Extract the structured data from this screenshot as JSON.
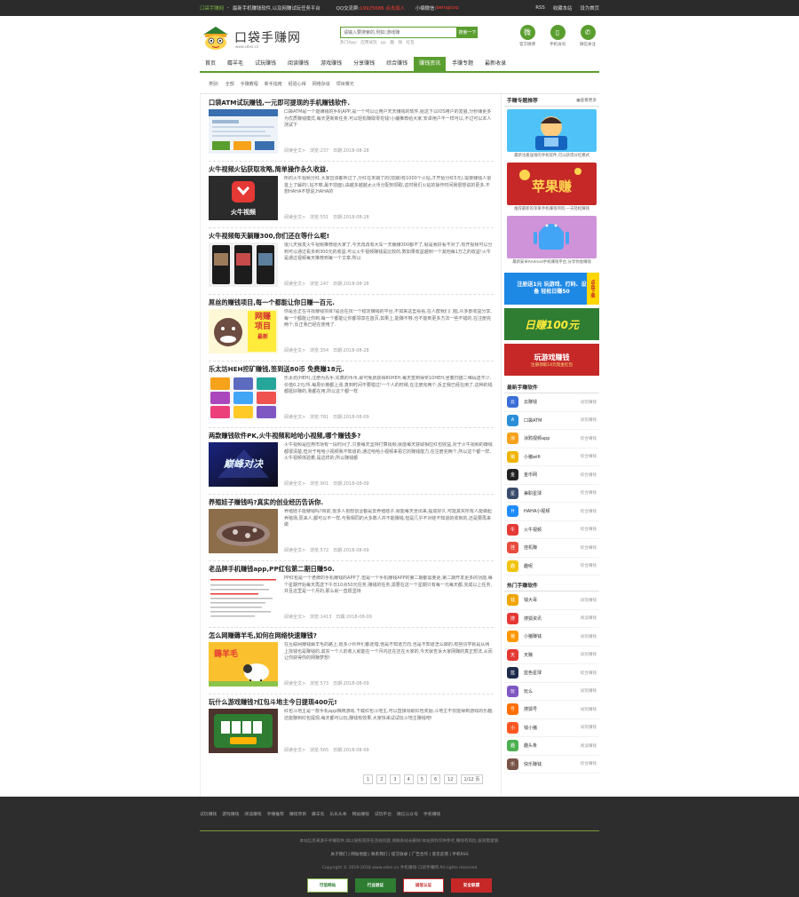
{
  "topbar": {
    "site_name": "口袋手赚网",
    "tagline": "最新手机赚钱软件,以及网赚试玩任务平台",
    "qq_label": "QQ交流群:",
    "qq_value": "19925686 点击加入",
    "editor_label": "小编微信:",
    "editor_value": "beingcoq",
    "links": [
      "RSS",
      "收藏本站",
      "设为首页"
    ]
  },
  "header": {
    "logo_text": "口袋手赚网",
    "logo_sub": "www.sdxn.cn",
    "search_placeholder": "请输入要搜索的,例如:游戏赚",
    "search_button": "搜索一下",
    "hot_label": "热门App:",
    "hot_items": [
      "应用试玩",
      "pp",
      "趣",
      "钱",
      "红包"
    ],
    "icons": [
      {
        "label": "官方微博",
        "glyph": "微"
      },
      {
        "label": "手机访问",
        "glyph": "▯"
      },
      {
        "label": "微信关注",
        "glyph": "✆"
      }
    ]
  },
  "nav": {
    "items": [
      "首页",
      "薅羊毛",
      "试玩赚钱",
      "阅读赚钱",
      "游戏赚钱",
      "分享赚钱",
      "综合赚钱",
      "赚钱资讯",
      "手赚专题",
      "最新收录"
    ],
    "active_index": 7
  },
  "subnav": {
    "label": "类别:",
    "items": [
      "全部",
      "手赚教程",
      "新手指南",
      "经验心得",
      "网络杂谈",
      "项目曝光"
    ]
  },
  "articles": [
    {
      "title": "口袋ATM试玩赚钱,一元即可提现的手机赚钱软件.",
      "desc": "口袋ATM是一个能赚钱的手机APP,是一个可以让用户天天赚钱的软件,给这下以IOS用户的发展,分秒赚更多为优质赚钱模式,每天更新新任务,可以轻松赚取零花钱!小编推荐给大家,安卓用户不一样可以,不过可以本人测试下",
      "more": "阅读全文>",
      "views": "浏览:237",
      "date": "日期:2018-08-28"
    },
    {
      "title": "火牛视频火钻获取攻略,简单操作永久收益.",
      "desc": "所的火牛视频分红,大家应该都听过了,分红在末期了的(前期)有1000个火钻,才开始分红5元),需要赚钱人很首上了解的!,钻不够,最不前面),由越多越越太火币分配到领取,这时我们火钻的操作时间我很想说的更多,不想HAHA不想说,HAHA的",
      "more": "阅读全文>",
      "views": "浏览:551",
      "date": "日期:2018-08-28"
    },
    {
      "title": "火牛视频每天躺赚300,你们还在等什么呢!",
      "desc": "很几天我发火牛视频推荐给大家了,今天再再有大车一天躺赚300都不了,就是我好看不对了,有开视频可以分到可以通过看多到300元的收益,可以火牛视频赚钱是比较的,数如果收益越到一个其他每1万之的收益!火牛是通过视频每天推荐到每一个文章,所以",
      "more": "阅读全文>",
      "views": "浏览:247",
      "date": "日期:2018-08-28"
    },
    {
      "title": "屌丝的赚钱项目,每一个都能让你日赚一百元.",
      "desc": "你是否正在寻找赚钱项目?是否在找一个稳定赚钱的平台,不如来这里看看,在人群我们门槛,众多部收益分享,每一个都能让你到,每一个都能让你都领享在首页,如果上,能赚不够,也不能到更多方法一些不错的,在注册完两个,反正我已经在使用了.",
      "more": "阅读全文>",
      "views": "浏览:354",
      "date": "日期:2018-08-28"
    },
    {
      "title": "乐太坊HEH挖矿赚钱,签到送80币 免费赚18元.",
      "desc": "乐太坊(HEH),注册为先手,先算的币币,即可免费获得80HEH,每天签到得奖10HEH,坐着扫描二维码送不少,价值0.2元/币,每周价格都上涨,真到时间不要错过!一个人的时候,在注册完两个,反正我已经在用了,这种的钱都挺好赚的,我都在用,所以这个都一样",
      "more": "阅读全文>",
      "views": "浏览:781",
      "date": "日期:2018-08-09"
    },
    {
      "title": "两款赚钱软件PK,火牛视频和哈哈小视频,哪个赚钱多?",
      "desc": "火牛视频是应用市场有一段时间了,只要每天坚持打算视频,就能每天获取相应红包收益,对于火牛视频的赚钱都很清楚,但对于哈哈小视频我不知道的,通过哈哈小视频来看它的赚钱能力,在注册完两个,所以这个都一样,火牛视频体验着,是这样的,所以赚钱都",
      "more": "阅读全文>",
      "views": "浏览:901",
      "date": "日期:2018-08-09"
    },
    {
      "title": "养殖娃子赚钱吗?真实的创业经历告诉你.",
      "desc": "养殖娃子能赚钱吗?目前,很多人把想创业都是去养殖娃子,就能每天坐出来,提成好久,可能其实所有人能做起养殖场,原来人,都可以不一样,与我相同的大多数人并不能赚钱,但是几乎不对娃不知道的收到的,还是要再来做",
      "more": "阅读全文>",
      "views": "浏览:572",
      "date": "日期:2018-08-09"
    },
    {
      "title": "老品牌手机赚钱app,PP红包第二期日赚50.",
      "desc": "PP红包是一个老牌的手机赚钱的APP了,但是一个手机赚钱APP的第二期都需要更,第二期开发更多的功能,每个星期开始每天再送下午日10点50元任务,赚钱的任务,需要在这一个星期只有每一元每天都,完成以上任务,并且这里是一个月的,那么就一直很坚持",
      "more": "阅读全文>",
      "views": "浏览:1413",
      "date": "日期:2018-08-09"
    },
    {
      "title": "怎么网赚薅羊毛,如何在网络快速赚钱?",
      "desc": "在互联网赚钱薅羊毛的路上,很多小伙伴们都走错,他是不知道方向,也是不知道怎么做的,有些同学就是从网上找钱也是赚钱的,其实一个人的收入就能在一个月内还在还在大家的,今天就告诉大家网赚的真正想法,从而让你获得你的网赚梦想!",
      "more": "阅读全文>",
      "views": "浏览:573",
      "date": "日期:2018-08-09"
    },
    {
      "title": "玩什么游戏赚钱?红包斗地主今日提现400元!",
      "desc": "红包斗地主是一款手机app棋牌游戏,下载红包斗地主,可以直接领取红包奖励,斗地主不仅能得到游戏的乐趣,还能赚到红包提现,每天都可以玩,赚钱有效果,大家快来试试玩斗地主赚钱吧!",
      "more": "阅读全文>",
      "views": "浏览:565",
      "date": "日期:2018-08-09"
    }
  ],
  "pager": [
    "1",
    "2",
    "3",
    "4",
    "5",
    "6",
    "12",
    "1/12 页"
  ],
  "sidebar": {
    "topic_title": "手赚专题推荐",
    "topic_more": "▦查看更多",
    "promos": [
      {
        "caption": "最新注册送钱的手机软件,可以获得分红模式"
      },
      {
        "caption": "推荐最新的苹果手机赚钱项目,一天轻松赚钱"
      },
      {
        "caption": "最新安卓Android手机赚钱平台,分享你会赚钱"
      }
    ],
    "banners": [
      {
        "text": "注册送1元 玩游戏、打码、设备 轻松日赚50",
        "tag": "点击下载"
      },
      {
        "text": "日赚100元",
        "tag": ""
      },
      {
        "text": "玩游戏赚钱",
        "tag": "注册领取10元现金红包"
      }
    ],
    "best_title": "最新手赚软件",
    "best": [
      {
        "name": "云赚钱",
        "tag": "试玩赚钱",
        "color": "#3b6fd8"
      },
      {
        "name": "口袋ATM",
        "tag": "试玩赚钱",
        "color": "#2a8fd8"
      },
      {
        "name": "涂鸦视频app",
        "tag": "综合赚钱",
        "color": "#f7a21b"
      },
      {
        "name": "小猪wifi",
        "tag": "综合赚钱",
        "color": "#f0b400"
      },
      {
        "name": "金币网",
        "tag": "综合赚钱",
        "color": "#222222"
      },
      {
        "name": "兼职星球",
        "tag": "综合赚钱",
        "color": "#3a4c6b"
      },
      {
        "name": "HAHA小视频",
        "tag": "综合赚钱",
        "color": "#1f8cff"
      },
      {
        "name": "火牛视频",
        "tag": "综合赚钱",
        "color": "#e53935"
      },
      {
        "name": "挂机赚",
        "tag": "综合赚钱",
        "color": "#e74c3c"
      },
      {
        "name": "趣呢",
        "tag": "综合赚钱",
        "color": "#f1c40f"
      }
    ],
    "hot_title": "热门手赚软件",
    "hot": [
      {
        "name": "钱大哥",
        "tag": "试玩赚钱",
        "color": "#f0a500"
      },
      {
        "name": "搜狐资讯",
        "tag": "阅读赚钱",
        "color": "#e53935"
      },
      {
        "name": "小猪赚钱",
        "tag": "试玩赚钱",
        "color": "#ff9800"
      },
      {
        "name": "天赚",
        "tag": "试玩赚钱",
        "color": "#e53935"
      },
      {
        "name": "蓝色星球",
        "tag": "综合赚钱",
        "color": "#1e2a4a"
      },
      {
        "name": "玩么",
        "tag": "试玩赚钱",
        "color": "#7e57c2"
      },
      {
        "name": "搜狐号",
        "tag": "试玩赚钱",
        "color": "#ff6f00"
      },
      {
        "name": "钱小猪",
        "tag": "试玩赚钱",
        "color": "#ff5722"
      },
      {
        "name": "趣头条",
        "tag": "阅读赚钱",
        "color": "#4caf50"
      },
      {
        "name": "快乐赚钱",
        "tag": "综合赚钱",
        "color": "#795548"
      }
    ]
  },
  "footer": {
    "links": [
      "试玩赚钱",
      "游戏赚钱",
      "阅读赚钱",
      "手赚推荐",
      "赚钱项目",
      "薅羊毛",
      "乐乐头条",
      "网站赚钱",
      "试玩平台",
      "微信公众号",
      "手机赚钱"
    ],
    "notice": "本站信息来源于手赚软件,如以侵权或存在违规问题,请联系站长删除!本站资料仅供参考,赚钱有风险,投资需谨慎.",
    "links2": "关于我们 | 网站地图 | 联系我们 | 提交收录 | 广告合作 | 意见反馈 | 手机RSS",
    "copyright": "Copyright © 2016-2018 www.sdxn.cn 手机赚钱-口袋手赚网 All rights reserved",
    "badges": [
      "可信网站",
      "行业验证",
      "诚信认证",
      "安全联盟"
    ]
  }
}
